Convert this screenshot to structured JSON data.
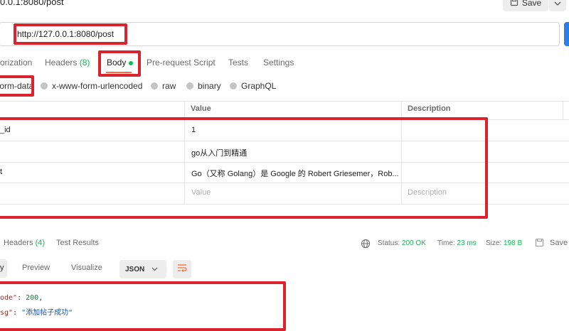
{
  "request": {
    "title": "0.0.1:8080/post",
    "save_label": "Save",
    "url": "http://127.0.0.1:8080/post"
  },
  "tabs": {
    "authorization": "orization",
    "headers": "Headers",
    "headers_count": "(8)",
    "body": "Body",
    "prerequest": "Pre-request Script",
    "tests": "Tests",
    "settings": "Settings"
  },
  "body_types": {
    "form_data": "form-data",
    "urlencoded": "x-www-form-urlencoded",
    "raw": "raw",
    "binary": "binary",
    "graphql": "GraphQL"
  },
  "params_table": {
    "headers": {
      "value": "Value",
      "description": "Description"
    },
    "rows": [
      {
        "key": "_id",
        "value": "1",
        "description": ""
      },
      {
        "key": "",
        "value": "go从入门到精通",
        "description": ""
      },
      {
        "key": "t",
        "value": "Go（又称 Golang）是 Google 的 Robert Griesemer，Rob...",
        "description": ""
      }
    ],
    "placeholder": {
      "value": "Value",
      "description": "Description"
    }
  },
  "response": {
    "tabs": {
      "headers": "Headers",
      "headers_count": "(4)",
      "test_results": "Test Results"
    },
    "status_label": "Status:",
    "status_value": "200 OK",
    "time_label": "Time:",
    "time_value": "23 ms",
    "size_label": "Size:",
    "size_value": "198 B",
    "save_label": "Save",
    "view_tabs": {
      "pretty": "y",
      "preview": "Preview",
      "visualize": "Visualize"
    },
    "format": "JSON",
    "body_lines": [
      {
        "key": "ode\"",
        "sep": ": ",
        "value": "200",
        "value_type": "num",
        "trail": ","
      },
      {
        "key": "sg\"",
        "sep": ": ",
        "value": "\"添加帖子成功\"",
        "value_type": "str",
        "trail": ""
      }
    ]
  },
  "colors": {
    "accent": "#ff6c37",
    "success": "#0cbb52",
    "annotation": "#d9232e",
    "send": "#2e7ee6"
  }
}
